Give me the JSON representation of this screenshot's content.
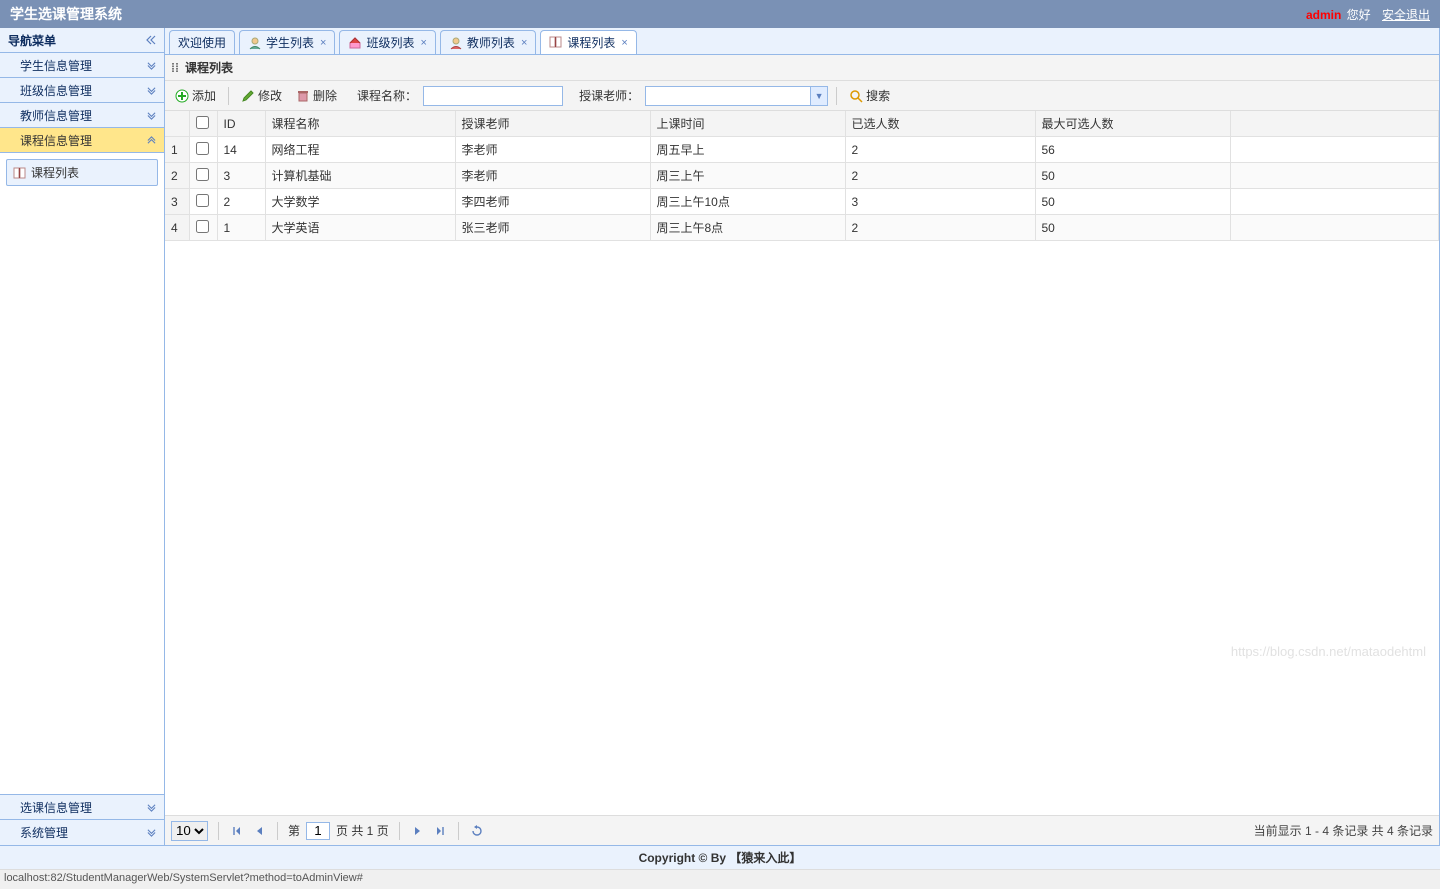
{
  "header": {
    "title": "学生选课管理系统",
    "user": "admin",
    "greeting": "您好",
    "logout": "安全退出"
  },
  "sidebar": {
    "title": "导航菜单",
    "items": [
      {
        "label": "学生信息管理",
        "expanded": false
      },
      {
        "label": "班级信息管理",
        "expanded": false
      },
      {
        "label": "教师信息管理",
        "expanded": false
      },
      {
        "label": "课程信息管理",
        "expanded": true,
        "children": [
          {
            "label": "课程列表"
          }
        ]
      },
      {
        "label": "选课信息管理",
        "expanded": false
      },
      {
        "label": "系统管理",
        "expanded": false
      }
    ]
  },
  "tabs": [
    {
      "label": "欢迎使用",
      "closable": false,
      "icon": "none"
    },
    {
      "label": "学生列表",
      "closable": true,
      "icon": "user"
    },
    {
      "label": "班级列表",
      "closable": true,
      "icon": "home"
    },
    {
      "label": "教师列表",
      "closable": true,
      "icon": "teacher"
    },
    {
      "label": "课程列表",
      "closable": true,
      "icon": "book",
      "active": true
    }
  ],
  "panel": {
    "title": "课程列表"
  },
  "toolbar": {
    "add": "添加",
    "edit": "修改",
    "delete": "删除",
    "name_label": "课程名称：",
    "name_value": "",
    "teacher_label": "授课老师：",
    "teacher_value": "",
    "search": "搜索"
  },
  "grid": {
    "columns": [
      "ID",
      "课程名称",
      "授课老师",
      "上课时间",
      "已选人数",
      "最大可选人数"
    ],
    "rows": [
      {
        "n": "1",
        "id": "14",
        "name": "网络工程",
        "teacher": "李老师",
        "time": "周五早上",
        "selected": "2",
        "max": "56"
      },
      {
        "n": "2",
        "id": "3",
        "name": "计算机基础",
        "teacher": "李老师",
        "time": "周三上午",
        "selected": "2",
        "max": "50"
      },
      {
        "n": "3",
        "id": "2",
        "name": "大学数学",
        "teacher": "李四老师",
        "time": "周三上午10点",
        "selected": "3",
        "max": "50"
      },
      {
        "n": "4",
        "id": "1",
        "name": "大学英语",
        "teacher": "张三老师",
        "time": "周三上午8点",
        "selected": "2",
        "max": "50"
      }
    ]
  },
  "pager": {
    "page_size": "10",
    "page_prefix": "第",
    "page_value": "1",
    "page_suffix": "页 共 1 页",
    "info": "当前显示 1 - 4 条记录 共 4 条记录"
  },
  "footer": {
    "copyright": "Copyright © By 【猿来入此】"
  },
  "status": {
    "url": "localhost:82/StudentManagerWeb/SystemServlet?method=toAdminView#"
  },
  "watermark": "https://blog.csdn.net/mataodehtml"
}
